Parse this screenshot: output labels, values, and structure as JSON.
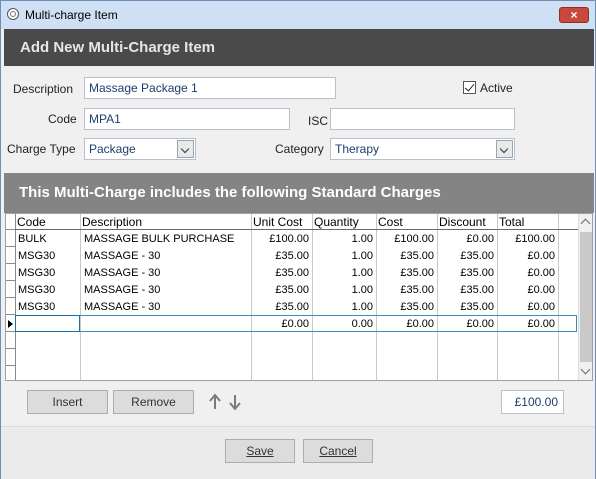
{
  "window": {
    "title": "Multi-charge Item",
    "close_glyph": "×"
  },
  "header_banner": "Add New Multi-Charge Item",
  "form": {
    "description_label": "Description",
    "description_value": "Massage Package 1",
    "active_label": "Active",
    "active_checked": true,
    "code_label": "Code",
    "code_value": "MPA1",
    "isc_label": "ISC",
    "isc_value": "",
    "charge_type_label": "Charge Type",
    "charge_type_value": "Package",
    "category_label": "Category",
    "category_value": "Therapy"
  },
  "section_banner": "This Multi-Charge includes the following Standard Charges",
  "grid": {
    "columns": [
      "Code",
      "Description",
      "Unit Cost",
      "Quantity",
      "Cost",
      "Discount",
      "Total"
    ],
    "rows": [
      [
        "BULK",
        "MASSAGE BULK PURCHASE",
        "£100.00",
        "1.00",
        "£100.00",
        "£0.00",
        "£100.00"
      ],
      [
        "MSG30",
        "MASSAGE - 30",
        "£35.00",
        "1.00",
        "£35.00",
        "£35.00",
        "£0.00"
      ],
      [
        "MSG30",
        "MASSAGE - 30",
        "£35.00",
        "1.00",
        "£35.00",
        "£35.00",
        "£0.00"
      ],
      [
        "MSG30",
        "MASSAGE - 30",
        "£35.00",
        "1.00",
        "£35.00",
        "£35.00",
        "£0.00"
      ],
      [
        "MSG30",
        "MASSAGE - 30",
        "£35.00",
        "1.00",
        "£35.00",
        "£35.00",
        "£0.00"
      ],
      [
        "",
        "",
        "£0.00",
        "0.00",
        "£0.00",
        "£0.00",
        "£0.00"
      ]
    ]
  },
  "actions": {
    "insert_label": "Insert",
    "remove_label": "Remove",
    "grand_total": "£100.00"
  },
  "footer": {
    "save_label": "Save",
    "cancel_label": "Cancel"
  },
  "icons": {
    "app": "app-icon",
    "close": "close-icon",
    "dropdown": "chevron-down-icon",
    "move_up": "arrow-up-icon",
    "move_down": "arrow-down-icon",
    "row_pointer": "row-pointer-icon"
  },
  "colors": {
    "banner": "#4a4a4a",
    "section_banner": "#848484",
    "titlebar": "#cfe0f4",
    "close_button": "#c9483c"
  }
}
